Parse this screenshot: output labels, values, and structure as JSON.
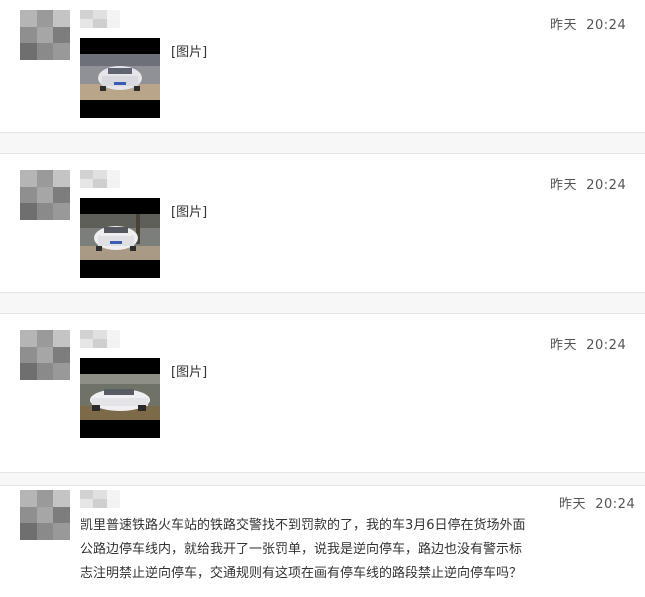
{
  "posts": [
    {
      "time": "昨天  20:24",
      "content": "[图片]"
    },
    {
      "time": "昨天  20:24",
      "content": "[图片]"
    },
    {
      "time": "昨天  20:24",
      "content": "[图片]"
    },
    {
      "time": "昨天  20:24",
      "lines": [
        "凯里普速铁路火车站的铁路交警找不到罚款的了，我的车3月6日停在货场外面",
        "公路边停车线内，就给我开了一张罚单，说我是逆向停车，路边也没有警示标",
        "志注明禁止逆向停车，交通规则有这项在画有停车线的路段禁止逆向停车吗？"
      ]
    }
  ]
}
